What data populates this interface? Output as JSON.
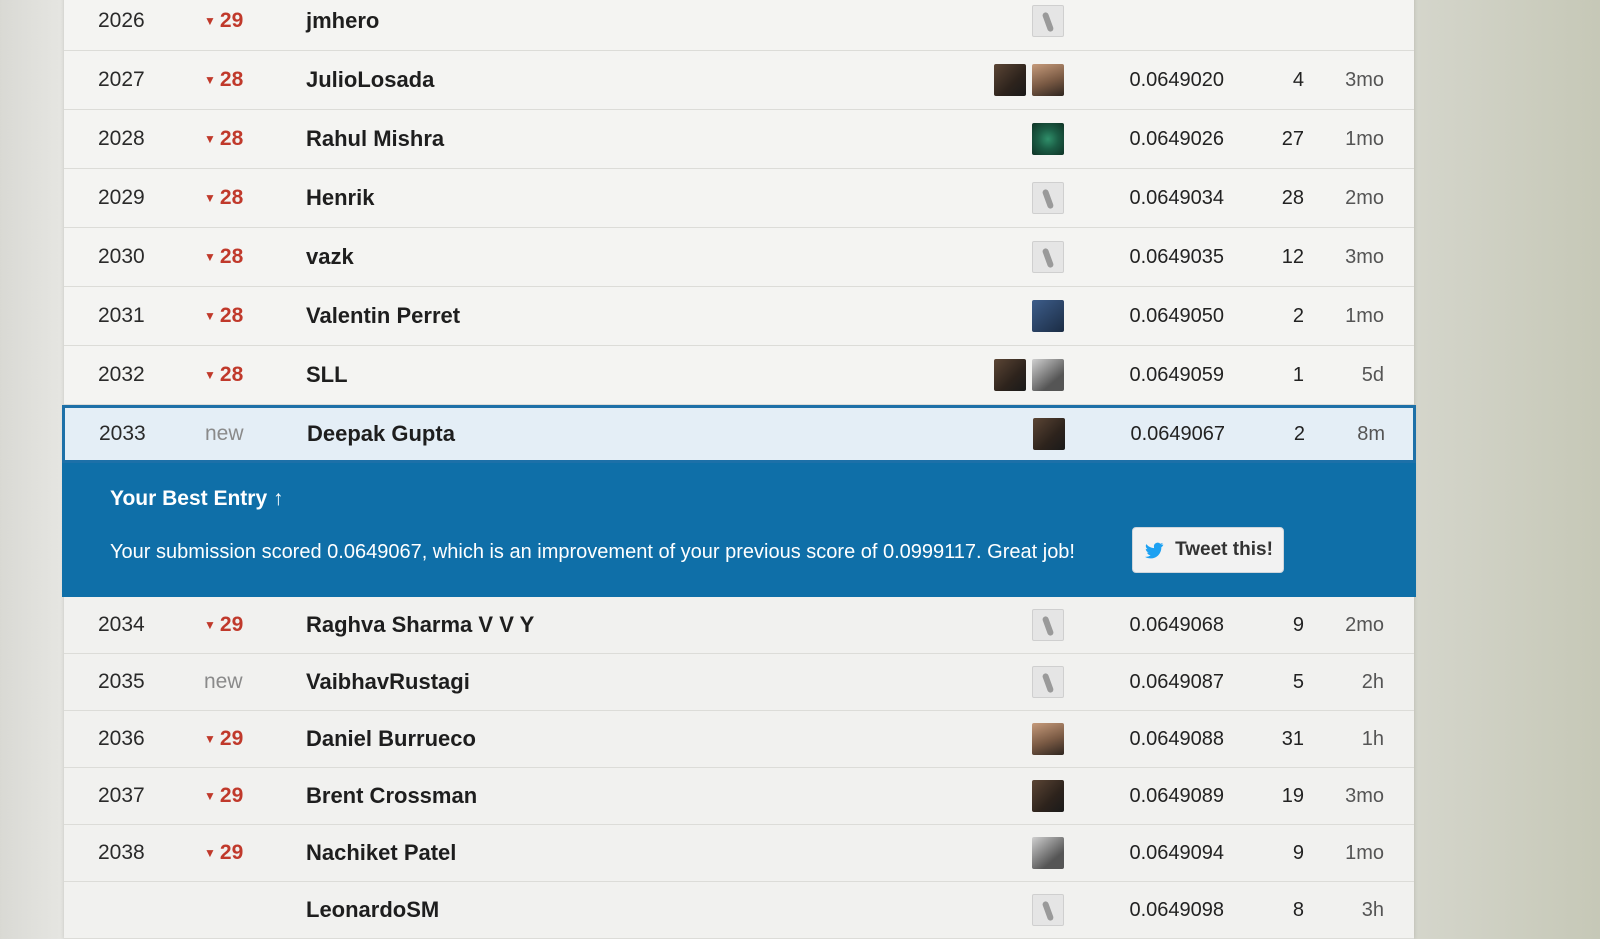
{
  "colors": {
    "accent": "#0f6fa8",
    "down": "#c0392b"
  },
  "rows_above": [
    {
      "rank": "2026",
      "delta": "29",
      "is_new": false,
      "name": "jmhero",
      "avatars": [
        "default"
      ],
      "score": "",
      "entries": "",
      "last": ""
    },
    {
      "rank": "2027",
      "delta": "28",
      "is_new": false,
      "name": "JulioLosada",
      "avatars": [
        "photo",
        "photo2"
      ],
      "score": "0.0649020",
      "entries": "4",
      "last": "3mo"
    },
    {
      "rank": "2028",
      "delta": "28",
      "is_new": false,
      "name": "Rahul Mishra",
      "avatars": [
        "peacock"
      ],
      "score": "0.0649026",
      "entries": "27",
      "last": "1mo"
    },
    {
      "rank": "2029",
      "delta": "28",
      "is_new": false,
      "name": "Henrik",
      "avatars": [
        "default"
      ],
      "score": "0.0649034",
      "entries": "28",
      "last": "2mo"
    },
    {
      "rank": "2030",
      "delta": "28",
      "is_new": false,
      "name": "vazk",
      "avatars": [
        "default"
      ],
      "score": "0.0649035",
      "entries": "12",
      "last": "3mo"
    },
    {
      "rank": "2031",
      "delta": "28",
      "is_new": false,
      "name": "Valentin Perret",
      "avatars": [
        "blue"
      ],
      "score": "0.0649050",
      "entries": "2",
      "last": "1mo"
    },
    {
      "rank": "2032",
      "delta": "28",
      "is_new": false,
      "name": "SLL",
      "avatars": [
        "photo",
        "gray"
      ],
      "score": "0.0649059",
      "entries": "1",
      "last": "5d"
    }
  ],
  "my_row": {
    "rank": "2033",
    "delta": "new",
    "name": "Deepak Gupta",
    "score": "0.0649067",
    "entries": "2",
    "last": "8m"
  },
  "best_entry": {
    "title": "Your Best Entry ↑",
    "message": "Your submission scored 0.0649067, which is an improvement of your previous score of 0.0999117. Great job!",
    "tweet_label": "Tweet this!"
  },
  "rows_below": [
    {
      "rank": "2034",
      "delta": "29",
      "is_new": false,
      "name": "Raghva Sharma V V Y",
      "avatars": [
        "default"
      ],
      "score": "0.0649068",
      "entries": "9",
      "last": "2mo"
    },
    {
      "rank": "2035",
      "delta": "new",
      "is_new": true,
      "name": "VaibhavRustagi",
      "avatars": [
        "default"
      ],
      "score": "0.0649087",
      "entries": "5",
      "last": "2h"
    },
    {
      "rank": "2036",
      "delta": "29",
      "is_new": false,
      "name": "Daniel Burrueco",
      "avatars": [
        "photo2"
      ],
      "score": "0.0649088",
      "entries": "31",
      "last": "1h"
    },
    {
      "rank": "2037",
      "delta": "29",
      "is_new": false,
      "name": "Brent Crossman",
      "avatars": [
        "photo"
      ],
      "score": "0.0649089",
      "entries": "19",
      "last": "3mo"
    },
    {
      "rank": "2038",
      "delta": "29",
      "is_new": false,
      "name": "Nachiket Patel",
      "avatars": [
        "gray"
      ],
      "score": "0.0649094",
      "entries": "9",
      "last": "1mo"
    },
    {
      "rank": "",
      "delta": "",
      "is_new": false,
      "name": "LeonardoSM",
      "avatars": [
        "default"
      ],
      "score": "0.0649098",
      "entries": "8",
      "last": "3h"
    }
  ]
}
